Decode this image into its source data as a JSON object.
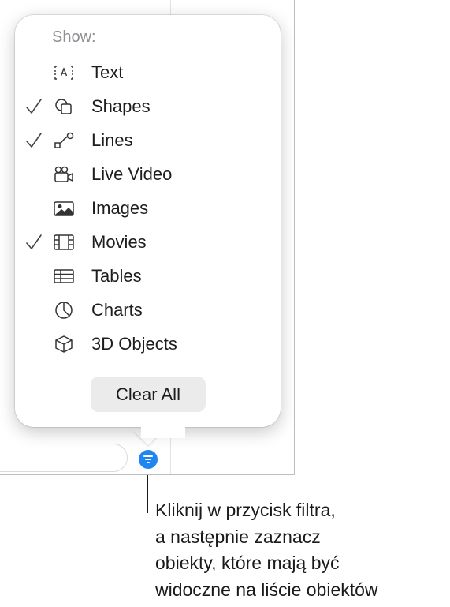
{
  "popover": {
    "title": "Show:",
    "items": [
      {
        "label": "Text",
        "checked": false,
        "icon": "text-box-icon"
      },
      {
        "label": "Shapes",
        "checked": true,
        "icon": "shapes-icon"
      },
      {
        "label": "Lines",
        "checked": true,
        "icon": "lines-icon"
      },
      {
        "label": "Live Video",
        "checked": false,
        "icon": "camera-icon"
      },
      {
        "label": "Images",
        "checked": false,
        "icon": "image-icon"
      },
      {
        "label": "Movies",
        "checked": true,
        "icon": "film-icon"
      },
      {
        "label": "Tables",
        "checked": false,
        "icon": "table-icon"
      },
      {
        "label": "Charts",
        "checked": false,
        "icon": "pie-chart-icon"
      },
      {
        "label": "3D Objects",
        "checked": false,
        "icon": "cube-icon"
      }
    ],
    "clear_label": "Clear All"
  },
  "filter_button": {
    "icon": "filter-icon",
    "color": "#1f85f0"
  },
  "caption": {
    "lines": [
      "Kliknij w przycisk filtra,",
      "a następnie zaznacz",
      "obiekty, które mają być",
      "widoczne na liście obiektów"
    ]
  },
  "colors": {
    "accent": "#1f85f0",
    "label": "#1d1d1f",
    "secondary": "#8e8e93"
  }
}
